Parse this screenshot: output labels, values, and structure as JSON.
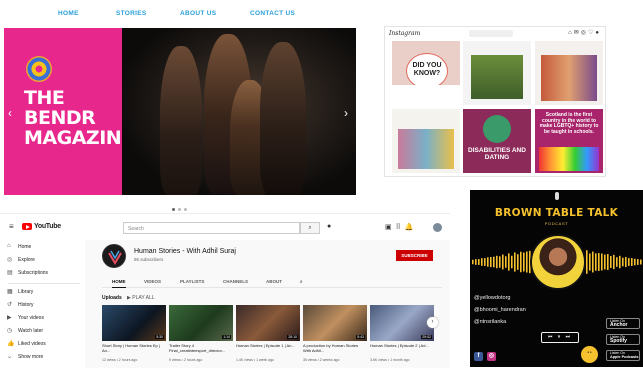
{
  "bendr": {
    "nav": [
      "HOME",
      "STORIES",
      "ABOUT US",
      "CONTACT US"
    ],
    "title_lines": [
      "THE",
      "BENDR",
      "MAGAZINE"
    ],
    "arrow_left": "‹",
    "arrow_right": "›"
  },
  "instagram": {
    "logo": "Instagram",
    "tiles": {
      "did_you_know": "DID YOU KNOW?",
      "disabilities": "DISABILITIES AND DATING",
      "lgbt": "Scotland is the first country in the world to make LGBTQ+ history to be taught in schools."
    }
  },
  "youtube": {
    "brand": "YouTube",
    "search_placeholder": "Search",
    "sidebar": [
      "Home",
      "Explore",
      "Subscriptions",
      "Library",
      "History",
      "Your videos",
      "Watch later",
      "Liked videos",
      "Show more"
    ],
    "channel": {
      "name": "Human Stories - With Adhil Suraj",
      "subscribers": "95 subscribers",
      "subscribe_label": "SUBSCRIBE",
      "tabs": [
        "HOME",
        "VIDEOS",
        "PLAYLISTS",
        "CHANNELS",
        "ABOUT"
      ]
    },
    "uploads_label": "Uploads",
    "play_all_label": "PLAY ALL",
    "videos": [
      {
        "title": "Short Story | Human Stories Ep | An...",
        "duration": "5:30",
        "meta": "12 views • 2 hours ago"
      },
      {
        "title": "Trailer Story 4 Final_creatinteesport_director...",
        "duration": "1:14",
        "meta": "9 views • 2 hours ago"
      },
      {
        "title": "Human Stories | Episode 1 | An...",
        "duration": "28:10",
        "meta": "1.4K views • 1 week ago"
      },
      {
        "title": "A production by Human Stories With Adhil...",
        "duration": "5:43",
        "meta": "35 views • 2 weeks ago"
      },
      {
        "title": "Human Stories | Episode 2 | Ad...",
        "duration": "29:02",
        "meta": "3.6K views • 1 month ago"
      }
    ]
  },
  "podcast": {
    "title": "BROWN TABLE TALK",
    "subtitle": "PODCAST",
    "handles": [
      "@yellowdotorg",
      "@bhoomi_harendran",
      "@ntnsrilanka"
    ],
    "player_controls": "⏮ ⏸ ⏭",
    "badges": [
      {
        "small": "Listen On",
        "big": "Anchor"
      },
      {
        "small": "Listen On",
        "big": "Spotify"
      },
      {
        "small": "Listen On",
        "big": "Apple Podcasts"
      }
    ],
    "colors": {
      "accent": "#f5c12e"
    }
  }
}
